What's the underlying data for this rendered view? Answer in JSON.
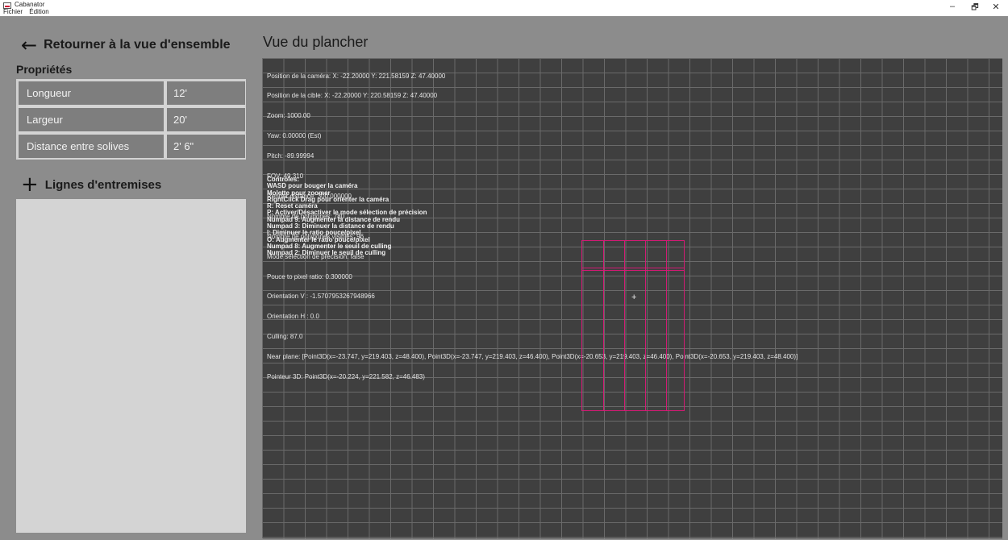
{
  "window": {
    "title": "Cabanator",
    "menu": [
      "Fichier",
      "Édition"
    ],
    "controls": {
      "minimize": "–",
      "restore": "🗗",
      "close": "✕"
    }
  },
  "sidebar": {
    "back_label": "Retourner à la vue d'ensemble",
    "properties_title": "Propriétés",
    "properties": [
      {
        "label": "Longueur",
        "value": "12'"
      },
      {
        "label": "Largeur",
        "value": "20'"
      },
      {
        "label": "Distance entre solives",
        "value": "2' 6\""
      }
    ],
    "add_label": "Lignes d'entremises"
  },
  "view": {
    "title": "Vue du plancher",
    "debug": [
      "Position de la caméra: X: -22.20000 Y: 221.58159 Z: 47.40000",
      "Position de la cible: X: -22.20000 Y: 220.58159 Z: 47.40000",
      "Zoom: 1000.00",
      "Yaw: 0.00000 (Est)",
      "Pitch: -89.99994",
      "FOV: 49.310",
      "Render distance: 300.000000",
      "Nombre de polygones: 780",
      "Nombre de polygones visibles: 96",
      "Mode sélection de précision: false",
      "Pouce to pixel ratio: 0.300000",
      "Orientation V : -1.5707953267948966",
      "Orientation H : 0.0",
      "Culling: 87.0",
      "Near plane: [Point3D(x=-23.747, y=219.403, z=48.400), Point3D(x=-23.747, y=219.403, z=46.400), Point3D(x=-20.653, y=219.403, z=46.400), Point3D(x=-20.653, y=219.403, z=48.400)]",
      "Pointeur 3D: Point3D(x=-20.224, y=221.582, z=46.483)"
    ],
    "controls": [
      "Controles:",
      "WASD pour bouger la caméra",
      "Molette pour zoomer",
      "RightClick Drag pour orienter la caméra",
      "R: Reset caméra",
      "P: Activer/Désactiver le mode sélection de précision",
      "Numpad 9: Augmenter la distance de rendu",
      "Numpad 3: Diminuer la distance de rendu",
      "I: Diminuer le ratio pouce/pixel",
      "O: Augmenter le ratio pouce/pixel",
      "Numpad 8: Augmenter le seuil de culling",
      "Numpad 2: Diminuer le seuil de culling"
    ],
    "accent_color": "#d21a74"
  }
}
